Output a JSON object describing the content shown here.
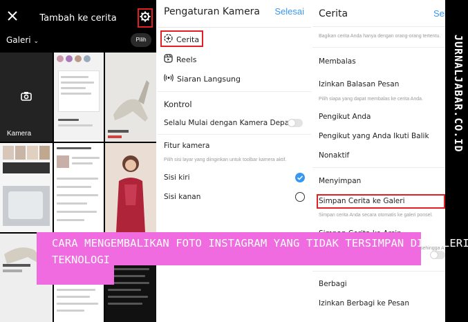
{
  "gallery": {
    "title": "Tambah ke cerita",
    "album_label": "Galeri",
    "select_label": "Pilih",
    "camera_label": "Kamera",
    "icons": [
      "close-icon",
      "gear-icon",
      "chevron-down-icon",
      "camera-icon"
    ],
    "accent_color": "#e02020"
  },
  "camera_settings": {
    "title": "Pengaturan Kamera",
    "done_label": "Selesai",
    "items": [
      {
        "label": "Cerita",
        "icon": "story-plus-icon"
      },
      {
        "label": "Reels",
        "icon": "reels-icon"
      },
      {
        "label": "Siaran Langsung",
        "icon": "live-icon"
      }
    ],
    "section_control": "Kontrol",
    "always_start_label": "Selalu Mulai dengan Kamera Depan",
    "always_start_enabled": false,
    "section_feature": "Fitur kamera",
    "feature_hint": "Pilih sisi layar yang diinginkan untuk toolbar kamera aktif.",
    "sides": [
      {
        "label": "Sisi kiri",
        "selected": true
      },
      {
        "label": "Sisi kanan",
        "selected": false
      }
    ],
    "link_color": "#3897f0"
  },
  "story_settings": {
    "title": "Cerita",
    "select_partial": "Sel",
    "top_hint": "Bagikan cerita Anda hanya dengan orang-orang tertentu.",
    "section_reply": "Membalas",
    "allow_reply_label": "Izinkan Balasan Pesan",
    "reply_hint": "Pilih siapa yang dapat membalas ke cerita Anda.",
    "reply_options": [
      "Pengikut Anda",
      "Pengikut yang Anda Ikuti Balik",
      "Nonaktif"
    ],
    "section_save": "Menyimpan",
    "save_to_gallery_label": "Simpan Cerita ke Galeri",
    "save_hint": "Simpan cerita Anda secara otomatis ke galeri ponsel.",
    "save_archive_label": "Simpan Cerita ke Arsip",
    "archive_hint_partial": "sehingga A",
    "section_share": "Berbagi",
    "allow_share_label": "Izinkan Berbagi ke Pesan"
  },
  "watermark": "JURNALJABAR.CO.ID",
  "banner": {
    "line1": "CARA MENGEMBALIKAN FOTO INSTAGRAM YANG TIDAK TERSIMPAN DI GALERI",
    "line2": "TEKNOLOGI",
    "color": "#f06ae0"
  }
}
